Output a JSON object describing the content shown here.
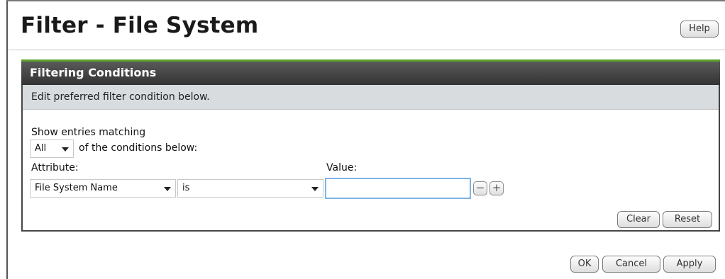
{
  "window": {
    "title": "Filter - File System",
    "help_label": "Help"
  },
  "panel": {
    "title": "Filtering Conditions",
    "instruction": "Edit preferred filter condition below.",
    "show_entries_label": "Show entries matching",
    "match_select_value": "All",
    "conditions_suffix": "of the conditions below:",
    "attribute_label": "Attribute:",
    "value_label": "Value:",
    "attribute_select_value": "File System Name",
    "operator_select_value": "is",
    "value_input": "",
    "remove_condition_label": "−",
    "add_condition_label": "+",
    "clear_label": "Clear",
    "reset_label": "Reset"
  },
  "footer": {
    "ok_label": "OK",
    "cancel_label": "Cancel",
    "apply_label": "Apply"
  },
  "colors": {
    "header_bg": "#3f3f3f",
    "header_accent": "#5aa02c",
    "subheader_bg": "#d8dcdf",
    "input_focus_border": "#7fb4e6"
  }
}
